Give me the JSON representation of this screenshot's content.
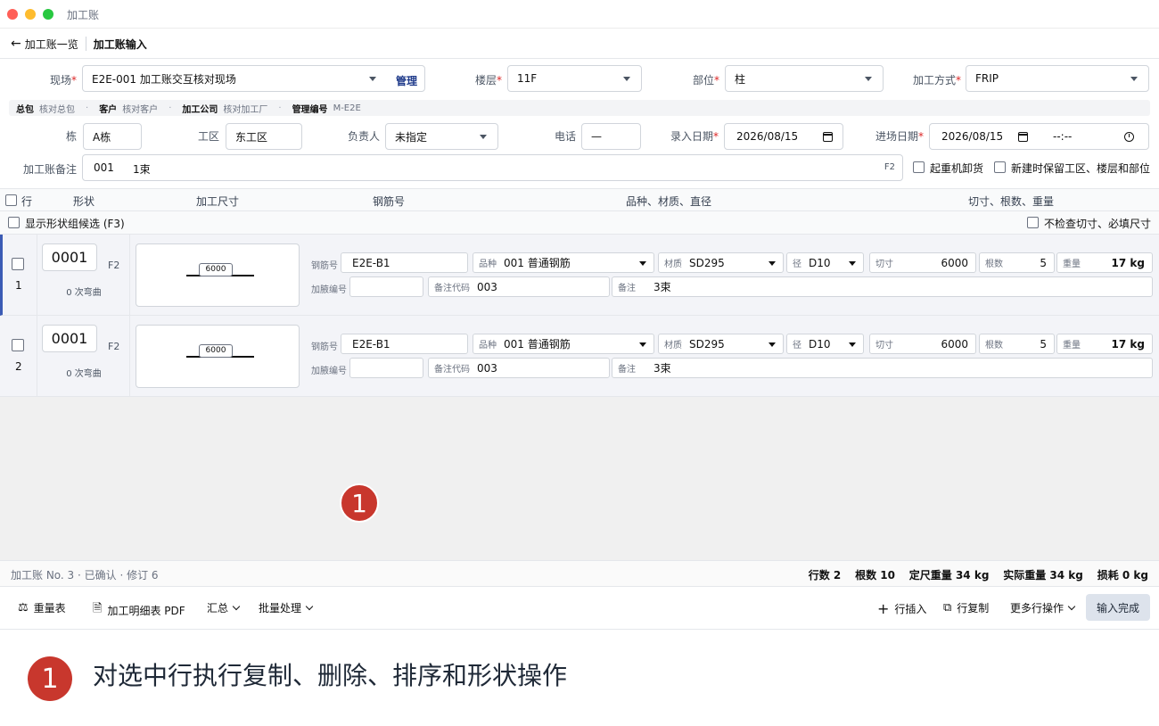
{
  "window": {
    "title": "加工账"
  },
  "nav": {
    "back_label": "加工账一览",
    "current": "加工账输入"
  },
  "form": {
    "site_label": "现场",
    "site_value": "E2E-001 加工账交互核对现场",
    "site_manage": "管理",
    "floor_label": "楼层",
    "floor_value": "11F",
    "part_label": "部位",
    "part_value": "柱",
    "method_label": "加工方式",
    "method_value": "FRIP",
    "required_mark": "*",
    "building_label": "栋",
    "building_value": "A栋",
    "zone_label": "工区",
    "zone_value": "东工区",
    "person_label": "负责人",
    "person_value": "未指定",
    "phone_label": "电话",
    "phone_value": "—",
    "entry_date_label": "录入日期",
    "entry_date_value": "2026/08/15",
    "arrival_date_label": "进场日期",
    "arrival_date_value": "2026/08/15",
    "arrival_time_value": "--:--",
    "note_label": "加工账备注",
    "note_code": "001",
    "note_value": "1束",
    "note_key": "F2",
    "crane_label": "起重机卸货",
    "keep_label": "新建时保留工区、楼层和部位"
  },
  "info": [
    {
      "key": "总包",
      "value": "核对总包"
    },
    {
      "key": "客户",
      "value": "核对客户"
    },
    {
      "key": "加工公司",
      "value": "核对加工厂"
    },
    {
      "key": "管理编号",
      "value": "M-E2E"
    }
  ],
  "table_header": {
    "row": "行",
    "shape": "形状",
    "size": "加工尺寸",
    "rebar_no": "钢筋号",
    "kind": "品种、材质、直径",
    "cut": "切寸、根数、重量"
  },
  "sub": {
    "show_candidates": "显示形状组候选 (F3)",
    "no_check": "不检查切寸、必填尺寸"
  },
  "row_labels": {
    "rebar_no": "钢筋号",
    "kind": "品种",
    "material": "材质",
    "dia": "径",
    "cut": "切寸",
    "count": "根数",
    "weight": "重量",
    "haunch": "加腋编号",
    "note_code": "备注代码",
    "note": "备注"
  },
  "rows": [
    {
      "no": "1",
      "shape": "0001",
      "key": "F2",
      "bend": "0 次弯曲",
      "dim": "6000",
      "rebar_no": "E2E-B1",
      "kind": "001 普通钢筋",
      "material": "SD295",
      "dia": "D10",
      "cut": "6000",
      "count": "5",
      "weight": "17 kg",
      "haunch": "",
      "note_code": "003",
      "note": "3束"
    },
    {
      "no": "2",
      "shape": "0001",
      "key": "F2",
      "bend": "0 次弯曲",
      "dim": "6000",
      "rebar_no": "E2E-B1",
      "kind": "001 普通钢筋",
      "material": "SD295",
      "dia": "D10",
      "cut": "6000",
      "count": "5",
      "weight": "17 kg",
      "haunch": "",
      "note_code": "003",
      "note": "3束"
    }
  ],
  "status": {
    "left": "加工账 No. 3 · 已确认 · 修订 6",
    "rows": "行数 2",
    "count": "根数 10",
    "fixed": "定尺重量 34 kg",
    "actual": "实际重量 34 kg",
    "loss": "损耗 0 kg"
  },
  "toolbar": {
    "weight_table": "重量表",
    "pdf": "加工明细表 PDF",
    "summary": "汇总",
    "batch": "批量处理",
    "insert": "行插入",
    "copy": "行复制",
    "more": "更多行操作",
    "done": "输入完成"
  },
  "annotation": {
    "number": "1",
    "caption": "对选中行执行复制、删除、排序和形状操作"
  },
  "colors": {
    "accent": "#3b5bb5",
    "badge": "#c8372d",
    "required": "#dc2626"
  }
}
